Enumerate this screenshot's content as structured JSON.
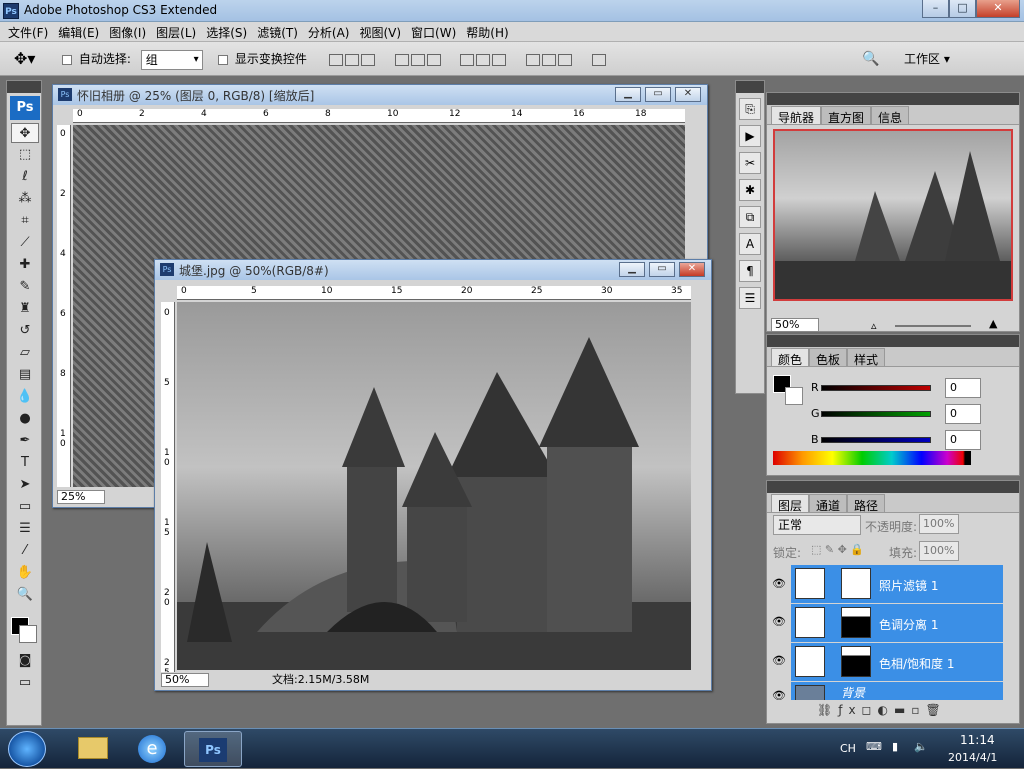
{
  "app": {
    "title": "Adobe Photoshop CS3 Extended",
    "window_buttons": [
      "–",
      "□",
      "✕"
    ]
  },
  "menu": [
    "文件(F)",
    "编辑(E)",
    "图像(I)",
    "图层(L)",
    "选择(S)",
    "滤镜(T)",
    "分析(A)",
    "视图(V)",
    "窗口(W)",
    "帮助(H)"
  ],
  "options": {
    "auto_select_label": "自动选择:",
    "auto_select_value": "组",
    "show_transform_label": "显示变换控件",
    "workspace_label": "工作区 ▾"
  },
  "doc1": {
    "title": "怀旧相册 @ 25% (图层 0, RGB/8) [缩放后]",
    "zoom": "25%",
    "ruler_h": [
      "0",
      "2",
      "4",
      "6",
      "8",
      "10",
      "12",
      "14",
      "16",
      "18"
    ],
    "ruler_v": [
      "0",
      "2",
      "4",
      "6",
      "8",
      "1\n0"
    ]
  },
  "doc2": {
    "title": "城堡.jpg @ 50%(RGB/8#)",
    "zoom": "50%",
    "doc_size": "文档:2.15M/3.58M",
    "ruler_h": [
      "0",
      "5",
      "10",
      "15",
      "20",
      "25",
      "30",
      "35"
    ],
    "ruler_v": [
      "0",
      "5",
      "1\n0",
      "1\n5",
      "2\n0",
      "2\n5"
    ]
  },
  "navigator": {
    "tabs": [
      "导航器",
      "直方图",
      "信息"
    ],
    "zoom": "50%"
  },
  "color": {
    "tabs": [
      "颜色",
      "色板",
      "样式"
    ],
    "channels": [
      {
        "label": "R",
        "value": "0",
        "color": "#c00000"
      },
      {
        "label": "G",
        "value": "0",
        "color": "#00a000"
      },
      {
        "label": "B",
        "value": "0",
        "color": "#0000c0"
      }
    ]
  },
  "layers": {
    "tabs": [
      "图层",
      "通道",
      "路径"
    ],
    "blend_mode": "正常",
    "opacity_label": "不透明度:",
    "opacity_value": "100%",
    "lock_label": "锁定:",
    "fill_label": "填充:",
    "fill_value": "100%",
    "items": [
      {
        "name": "照片滤镜 1"
      },
      {
        "name": "色调分离 1"
      },
      {
        "name": "色相/饱和度 1"
      },
      {
        "name": "背景"
      }
    ]
  },
  "taskbar": {
    "lang": "CH",
    "time": "11:14",
    "date": "2014/4/1"
  }
}
